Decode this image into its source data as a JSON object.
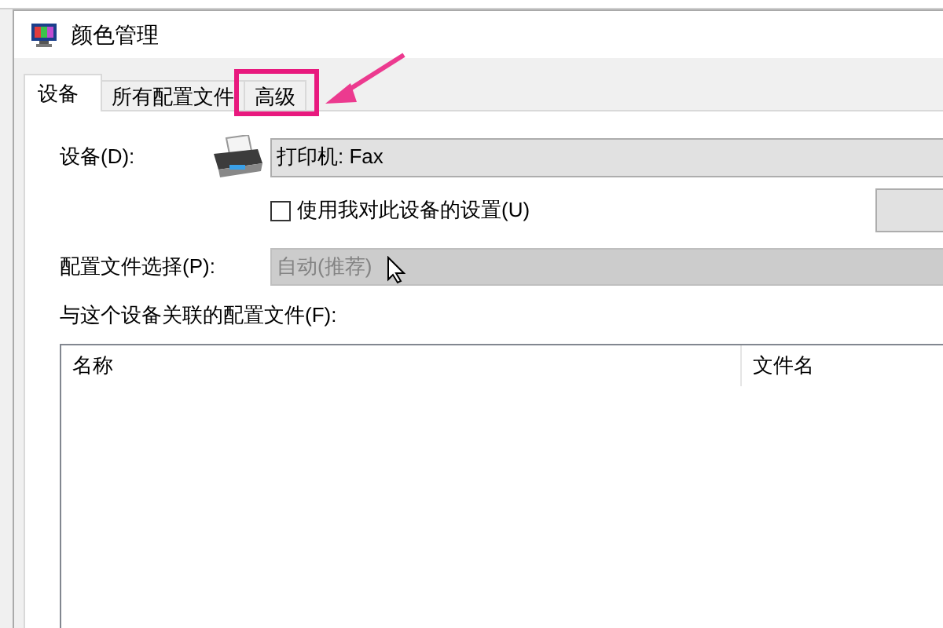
{
  "window": {
    "title": "颜色管理"
  },
  "tabs": [
    {
      "label": "设备",
      "selected": true
    },
    {
      "label": "所有配置文件",
      "selected": false
    },
    {
      "label": "高级",
      "selected": false
    }
  ],
  "device": {
    "label": "设备(D):",
    "value": "打印机: Fax"
  },
  "use_my_settings": {
    "label": "使用我对此设备的设置(U)",
    "checked": false
  },
  "profile_selection": {
    "label": "配置文件选择(P):",
    "value": "自动(推荐)",
    "disabled": true
  },
  "profiles_list": {
    "label": "与这个设备关联的配置文件(F):",
    "columns": [
      "名称",
      "文件名"
    ]
  }
}
